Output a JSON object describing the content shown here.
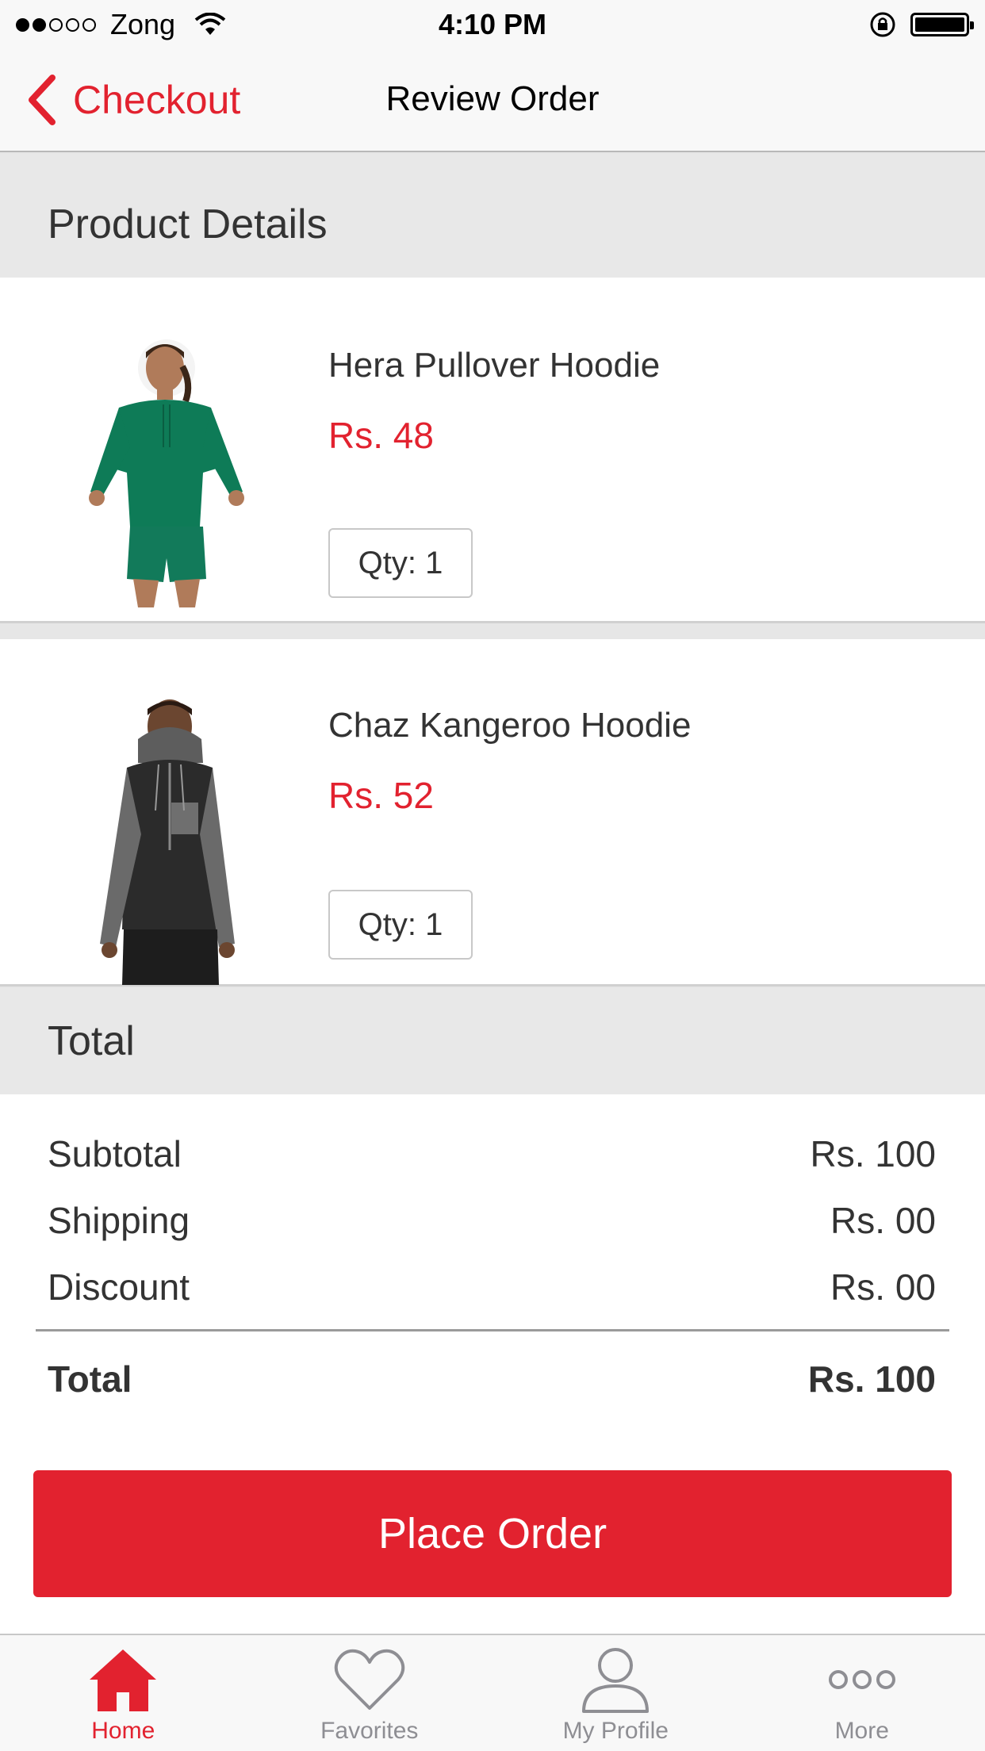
{
  "status_bar": {
    "carrier": "Zong",
    "time": "4:10 PM",
    "signal_bars_filled": 2,
    "signal_bars_total": 5
  },
  "nav": {
    "back_label": "Checkout",
    "title": "Review Order"
  },
  "sections": {
    "product_details": "Product Details",
    "total": "Total"
  },
  "products": [
    {
      "name": "Hera Pullover Hoodie",
      "price": "Rs. 48",
      "qty": "Qty: 1"
    },
    {
      "name": "Chaz Kangeroo Hoodie",
      "price": "Rs. 52",
      "qty": "Qty: 1"
    }
  ],
  "totals": {
    "subtotal_label": "Subtotal",
    "subtotal_value": "Rs. 100",
    "shipping_label": "Shipping",
    "shipping_value": "Rs. 00",
    "discount_label": "Discount",
    "discount_value": "Rs. 00",
    "total_label": "Total",
    "total_value": "Rs. 100"
  },
  "place_order_label": "Place Order",
  "tabs": [
    {
      "label": "Home",
      "icon": "house-icon",
      "active": true
    },
    {
      "label": "Favorites",
      "icon": "heart-icon",
      "active": false
    },
    {
      "label": "My Profile",
      "icon": "person-icon",
      "active": false
    },
    {
      "label": "More",
      "icon": "ellipsis-icon",
      "active": false
    }
  ],
  "colors": {
    "accent": "#e2222f",
    "section_bg": "#e8e8e8",
    "inactive_tab": "#8e8e93"
  }
}
